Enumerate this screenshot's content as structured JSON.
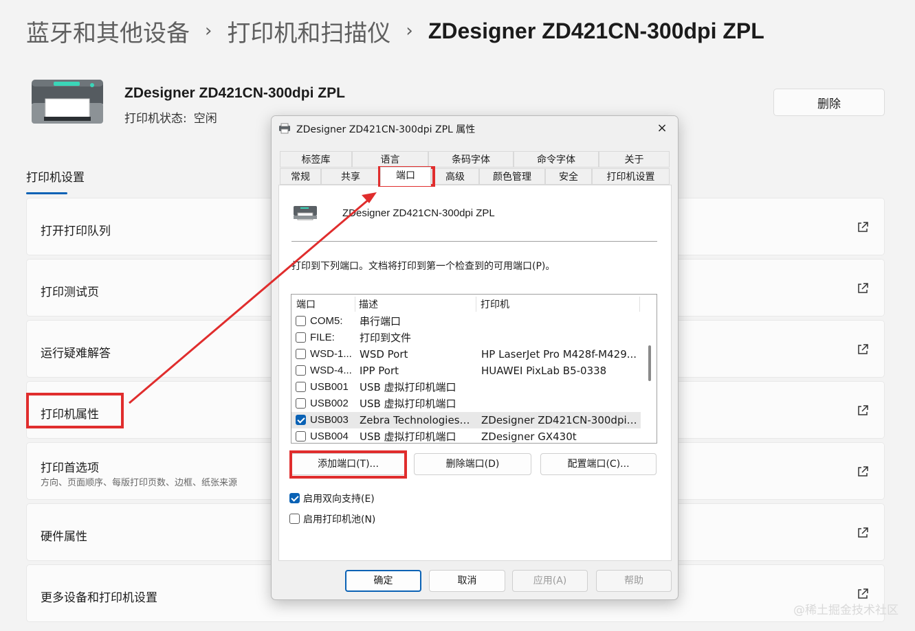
{
  "breadcrumb": {
    "item1": "蓝牙和其他设备",
    "item2": "打印机和扫描仪",
    "current": "ZDesigner ZD421CN-300dpi ZPL",
    "separator": "›"
  },
  "printer": {
    "name": "ZDesigner ZD421CN-300dpi ZPL",
    "status_label": "打印机状态:",
    "status_value": "空闲",
    "delete_label": "删除"
  },
  "settings": {
    "title": "打印机设置",
    "items": [
      {
        "label": "打开打印队列"
      },
      {
        "label": "打印测试页"
      },
      {
        "label": "运行疑难解答"
      },
      {
        "label": "打印机属性"
      },
      {
        "label": "打印首选项",
        "sub": "方向、页面顺序、每版打印页数、边框、纸张来源"
      },
      {
        "label": "硬件属性"
      },
      {
        "label": "更多设备和打印机设置"
      }
    ]
  },
  "dialog": {
    "title": "ZDesigner ZD421CN-300dpi ZPL 属性",
    "close_icon": "×",
    "tabs_top": [
      "标签库",
      "语言",
      "条码字体",
      "命令字体",
      "关于"
    ],
    "tabs_bottom": [
      "常规",
      "共享",
      "端口",
      "高级",
      "颜色管理",
      "安全",
      "打印机设置"
    ],
    "active_tab": "端口",
    "printer_name": "ZDesigner ZD421CN-300dpi ZPL",
    "instruction": "打印到下列端口。文档将打印到第一个检查到的可用端口(P)。",
    "columns": [
      "端口",
      "描述",
      "打印机"
    ],
    "ports": [
      {
        "port": "COM5:",
        "desc": "串行端口",
        "printer": "",
        "checked": false
      },
      {
        "port": "FILE:",
        "desc": "打印到文件",
        "printer": "",
        "checked": false
      },
      {
        "port": "WSD-1...",
        "desc": "WSD Port",
        "printer": "HP LaserJet Pro M428f-M429...",
        "checked": false
      },
      {
        "port": "WSD-4...",
        "desc": "IPP Port",
        "printer": "HUAWEI PixLab B5-0338",
        "checked": false
      },
      {
        "port": "USB001",
        "desc": "USB 虚拟打印机端口",
        "printer": "",
        "checked": false
      },
      {
        "port": "USB002",
        "desc": "USB 虚拟打印机端口",
        "printer": "",
        "checked": false
      },
      {
        "port": "USB003",
        "desc": "Zebra Technologies ...",
        "printer": "ZDesigner ZD421CN-300dpi ...",
        "checked": true
      },
      {
        "port": "USB004",
        "desc": "USB 虚拟打印机端口",
        "printer": "ZDesigner GX430t",
        "checked": false
      }
    ],
    "add_port": "添加端口(T)...",
    "delete_port": "删除端口(D)",
    "config_port": "配置端口(C)...",
    "bidirectional": {
      "label": "启用双向支持(E)",
      "checked": true
    },
    "pooling": {
      "label": "启用打印机池(N)",
      "checked": false
    },
    "ok": "确定",
    "cancel": "取消",
    "apply": "应用(A)",
    "help": "帮助"
  },
  "watermark": "@稀土掘金技术社区",
  "colors": {
    "accent": "#0a62b5",
    "highlight": "#e02d2d"
  }
}
